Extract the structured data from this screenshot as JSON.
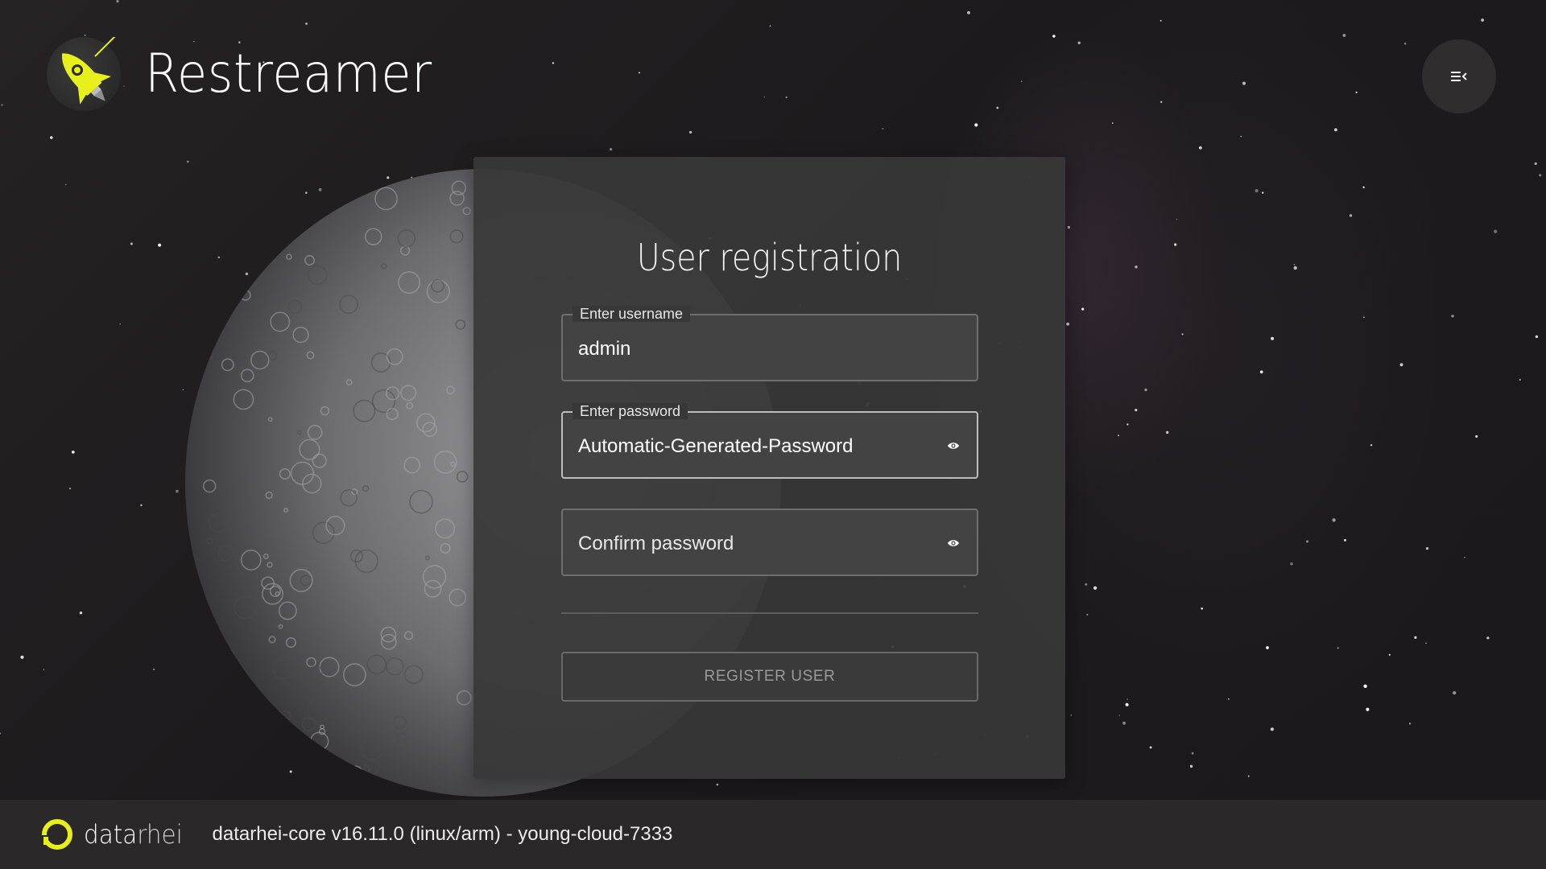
{
  "header": {
    "app_name": "Restreamer",
    "logo_icon": "rocket-icon",
    "menu_icon": "menu-collapse-icon",
    "accent_color": "#e8f01c"
  },
  "registration": {
    "title": "User registration",
    "username": {
      "label": "Enter username",
      "value": "admin"
    },
    "password": {
      "label": "Enter password",
      "value": "Automatic-Generated-Password",
      "toggle_icon": "eye-icon"
    },
    "confirm_password": {
      "placeholder": "Confirm password",
      "toggle_icon": "eye-icon"
    },
    "submit_label": "REGISTER USER"
  },
  "footer": {
    "brand_primary": "data",
    "brand_secondary": "rhei",
    "version_text": "datarhei-core v16.11.0 (linux/arm) - young-cloud-7333",
    "logo_color": "#e8f01c"
  }
}
